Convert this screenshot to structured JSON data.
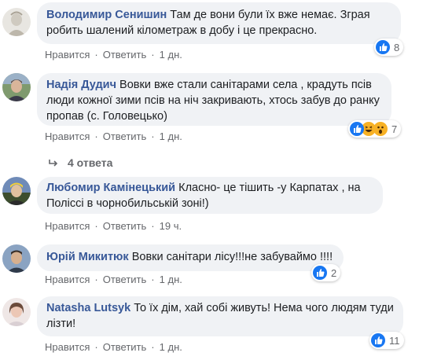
{
  "comments": [
    {
      "author": "Володимир Сенишин",
      "text": "Там де вони були їх вже немає. Зграя робить шалений кілометраж в добу і це прекрасно.",
      "like_label": "Нравится",
      "reply_label": "Ответить",
      "time": "1 дн.",
      "reaction_count": "8",
      "reactions": [
        "like-icon"
      ]
    },
    {
      "author": "Надія Дудич",
      "text": "Вовки вже стали санітарами села , крадуть псів люди кожної зими псів на ніч закривають, хтось забув до ранку пропав (с. Головецько)",
      "like_label": "Нравится",
      "reply_label": "Ответить",
      "time": "1 дн.",
      "reaction_count": "7",
      "reactions": [
        "like-icon",
        "haha-icon",
        "wow-icon"
      ]
    },
    {
      "author": "Любомир Камінецький",
      "text": "Класно- це тішить -у Карпатах , на Поліссі в чорнобильській зоні!)",
      "like_label": "Нравится",
      "reply_label": "Ответить",
      "time": "19 ч."
    },
    {
      "author": "Юрій Микитюк",
      "text": "Вовки санітари лісу!!!не забуваймо !!!!",
      "like_label": "Нравится",
      "reply_label": "Ответить",
      "time": "1 дн.",
      "reaction_count": "2",
      "reactions": [
        "like-icon"
      ]
    },
    {
      "author": "Natasha Lutsyk",
      "text": "То їх дім, хай собі живуть! Нема чого людям туди лізти!",
      "like_label": "Нравится",
      "reply_label": "Ответить",
      "time": "1 дн.",
      "reaction_count": "11",
      "reactions": [
        "like-icon"
      ]
    }
  ],
  "replies_link": "4 ответа",
  "separator": "·",
  "colors": {
    "author": "#385898",
    "meta": "#65676b",
    "bubble": "#f0f2f5",
    "like": "#1877f2"
  }
}
